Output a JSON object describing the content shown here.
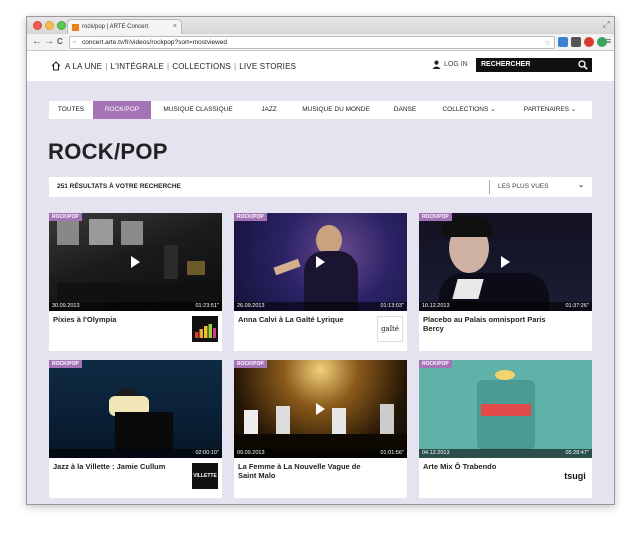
{
  "browser": {
    "tab_title": "rock/pop | ARTE Concert",
    "tab_close": "×",
    "url": "concert.arte.tv/fr/videos/rockpop?sort=mostviewed",
    "back": "←",
    "forward": "→",
    "reload": "C",
    "resize": "⤢"
  },
  "header": {
    "nav": [
      "A LA UNE",
      "L'INTÉGRALE",
      "COLLECTIONS",
      "LIVE STORIES"
    ],
    "login_label": "LOG IN",
    "search_label": "RECHERCHER"
  },
  "categories": [
    {
      "label": "TOUTES",
      "active": false
    },
    {
      "label": "ROCK/POP",
      "active": true
    },
    {
      "label": "MUSIQUE CLASSIQUE",
      "active": false
    },
    {
      "label": "JAZZ",
      "active": false
    },
    {
      "label": "MUSIQUE DU MONDE",
      "active": false
    },
    {
      "label": "DANSE",
      "active": false
    },
    {
      "label": "COLLECTIONS ⌄",
      "active": false
    },
    {
      "label": "PARTENAIRES ⌄",
      "active": false
    }
  ],
  "page_title": "ROCK/POP",
  "results": {
    "count_label": "251 RÉSULTATS À VOTRE RECHERCHE",
    "sort_label": "LES PLUS VUES",
    "chevron": "⌄"
  },
  "videos": [
    {
      "badge": "ROCK/POP",
      "date": "30.09.2013",
      "duration": "01:23:51''",
      "title": "Pixies à l'Olympia",
      "logo": "deezer-logo"
    },
    {
      "badge": "ROCK/POP",
      "date": "26.09.2013",
      "duration": "01:13:03''",
      "title": "Anna Calvi à La Gaîté Lyrique",
      "logo": "gaite-lyrique-logo",
      "logo_text": "gaîté"
    },
    {
      "badge": "ROCK/POP",
      "date": "10.12.2013",
      "duration": "01:37:26''",
      "title": "Placebo au Palais omnisport Paris Bercy",
      "logo": "none"
    },
    {
      "badge": "ROCK/POP",
      "date": "",
      "duration": "02:00:10''",
      "title": "Jazz à la Villette : Jamie Cullum",
      "logo": "villette-logo",
      "logo_text": "VILLETTE"
    },
    {
      "badge": "ROCK/POP",
      "date": "09.09.2013",
      "duration": "01:01:56''",
      "title": "La Femme à La Nouvelle Vague de Saint Malo",
      "logo": "none"
    },
    {
      "badge": "ROCK/POP",
      "date": "04.12.2013",
      "duration": "05:28:47''",
      "title": "Arte Mix Ô Trabendo",
      "logo": "tsugi-logo",
      "logo_text": "tsugi"
    }
  ],
  "colors": {
    "accent": "#a574b6",
    "content_bg": "#e6e3f1"
  }
}
